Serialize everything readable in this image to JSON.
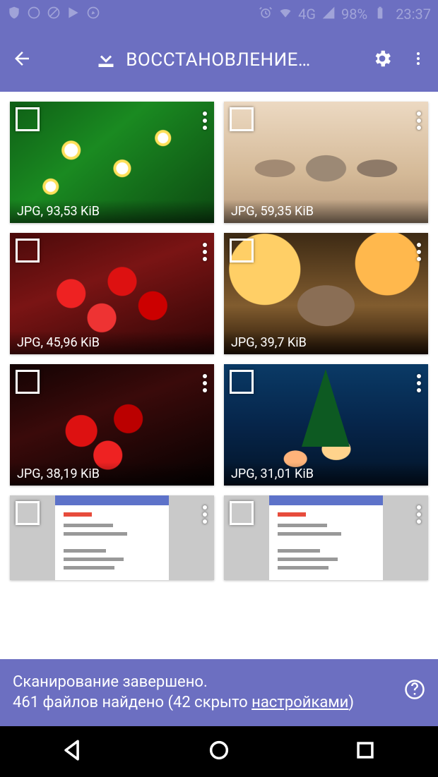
{
  "status_bar": {
    "network_label": "4G",
    "battery_label": "98%",
    "time": "23:37"
  },
  "app_bar": {
    "title": "ВОССТАНОВЛЕНИЕ…"
  },
  "tiles": [
    {
      "label": "JPG, 93,53 KiB",
      "thumb": "thumb-daisies"
    },
    {
      "label": "JPG, 59,35 KiB",
      "thumb": "thumb-kittens"
    },
    {
      "label": "JPG, 45,96 KiB",
      "thumb": "thumb-rasp1"
    },
    {
      "label": "JPG, 39,7 KiB",
      "thumb": "thumb-cat"
    },
    {
      "label": "JPG, 38,19 KiB",
      "thumb": "thumb-rasp2"
    },
    {
      "label": "JPG, 31,01 KiB",
      "thumb": "thumb-tree"
    },
    {
      "label": "",
      "thumb": "thumb-doc",
      "partial": true
    },
    {
      "label": "",
      "thumb": "thumb-doc",
      "partial": true
    }
  ],
  "snackbar": {
    "line1": "Сканирование завершено.",
    "line2_pre": "461 файлов найдено (42 скрыто ",
    "link": "настройками",
    "line2_post": ")"
  }
}
